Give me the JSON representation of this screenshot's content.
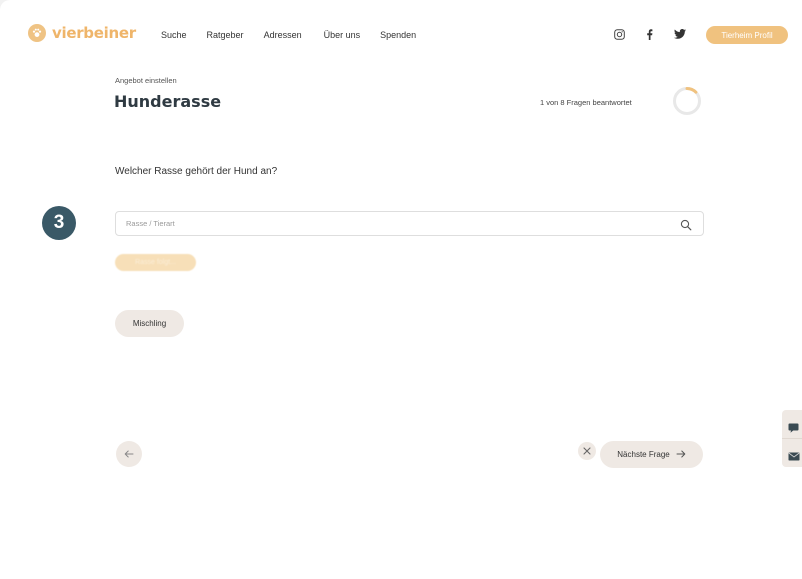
{
  "brand": {
    "name": "vierbeiner",
    "color": "#efb56a"
  },
  "nav": {
    "items": [
      "Suche",
      "Ratgeber",
      "Adressen",
      "Über uns",
      "Spenden"
    ]
  },
  "social": [
    "instagram-icon",
    "facebook-icon",
    "twitter-icon"
  ],
  "header": {
    "profile_label": "Tierheim Profil"
  },
  "form": {
    "kicker": "Angebot einstellen",
    "title": "Hunderasse",
    "progress_text": "1 von 8 Fragen beantwortet",
    "progress_fraction": 0.125,
    "question": "Welcher Rasse gehört der Hund an?",
    "step_badge": "3",
    "search_placeholder": "Rasse / Tierart",
    "filter_label": "Rasse folgt...",
    "chip_label": "Mischling",
    "next_label": "Nächste Frage"
  },
  "colors": {
    "accent": "#f0c27f",
    "badge": "#3a5967",
    "chip": "#efe9e4",
    "title": "#2f3a42"
  }
}
